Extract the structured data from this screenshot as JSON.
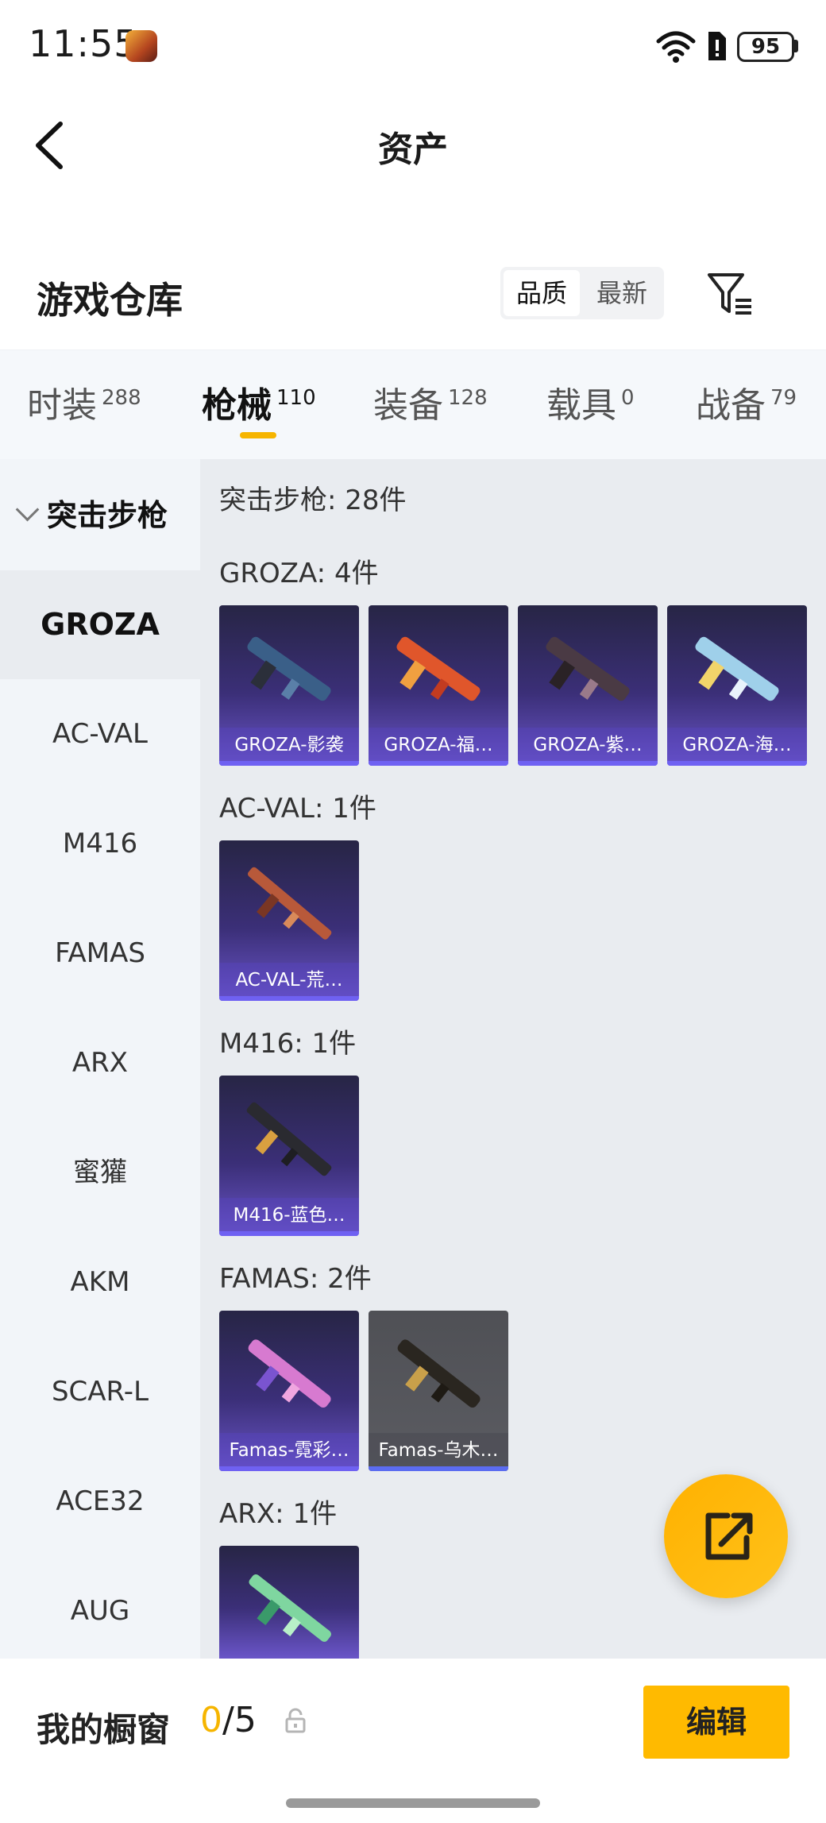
{
  "status": {
    "time": "11:55",
    "battery": "95"
  },
  "header": {
    "title": "资产"
  },
  "warehouse": {
    "title": "游戏仓库",
    "sort_quality": "品质",
    "sort_newest": "最新"
  },
  "tabs": [
    {
      "label": "时装",
      "count": "288"
    },
    {
      "label": "枪械",
      "count": "110"
    },
    {
      "label": "装备",
      "count": "128"
    },
    {
      "label": "载具",
      "count": "0"
    },
    {
      "label": "战备",
      "count": "79"
    }
  ],
  "sidebar": {
    "category": "突击步枪",
    "items": [
      "GROZA",
      "AC-VAL",
      "M416",
      "FAMAS",
      "ARX",
      "蜜獾",
      "AKM",
      "SCAR-L",
      "ACE32",
      "AUG"
    ]
  },
  "content": {
    "total": "突击步枪: 28件",
    "sections": [
      {
        "label": "GROZA: 4件",
        "items": [
          "GROZA-影袭",
          "GROZA-福…",
          "GROZA-紫…",
          "GROZA-海…"
        ]
      },
      {
        "label": "AC-VAL: 1件",
        "items": [
          "AC-VAL-荒…"
        ]
      },
      {
        "label": "M416: 1件",
        "items": [
          "M416-蓝色…"
        ]
      },
      {
        "label": "FAMAS: 2件",
        "items": [
          "Famas-霓彩…",
          "Famas-乌木…"
        ]
      },
      {
        "label": "ARX: 1件",
        "items": [
          ""
        ]
      }
    ]
  },
  "bottom": {
    "showcase_label": "我的橱窗",
    "count_current": "0",
    "count_total": "/5",
    "edit_label": "编辑"
  },
  "colors": {
    "accent": "#f6b500",
    "card_purple": "#3b2f78",
    "card_gray": "#55565c"
  }
}
